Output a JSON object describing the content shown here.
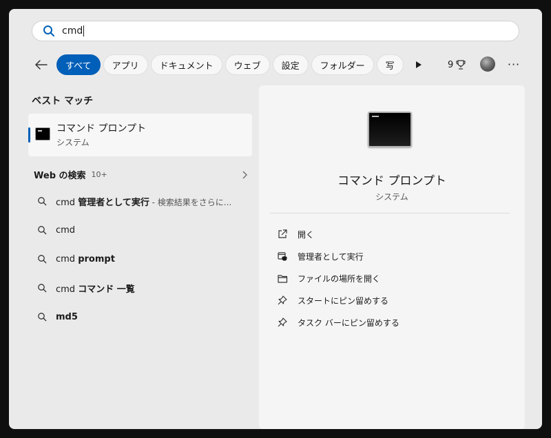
{
  "search": {
    "query": "cmd"
  },
  "filters": {
    "chips": [
      {
        "label": "すべて",
        "active": true
      },
      {
        "label": "アプリ",
        "active": false
      },
      {
        "label": "ドキュメント",
        "active": false
      },
      {
        "label": "ウェブ",
        "active": false
      },
      {
        "label": "設定",
        "active": false
      },
      {
        "label": "フォルダー",
        "active": false
      },
      {
        "label": "写",
        "active": false
      }
    ],
    "points": "9"
  },
  "left": {
    "best_match_title": "ベスト マッチ",
    "best_match": {
      "title": "コマンド プロンプト",
      "subtitle": "システム"
    },
    "web_title": "Web の検索",
    "web_count": "10+",
    "results": [
      {
        "plain": "cmd ",
        "bold": "管理者として実行",
        "suffix": " - 検索結果をさらに..."
      },
      {
        "plain": "cmd",
        "bold": "",
        "suffix": ""
      },
      {
        "plain": "cmd ",
        "bold": "prompt",
        "suffix": ""
      },
      {
        "plain": "cmd ",
        "bold": "コマンド 一覧",
        "suffix": ""
      },
      {
        "plain": "",
        "bold": "md5",
        "suffix": ""
      }
    ]
  },
  "detail": {
    "title": "コマンド プロンプト",
    "subtitle": "システム",
    "actions": [
      {
        "label": "開く",
        "icon": "open-external-icon"
      },
      {
        "label": "管理者として実行",
        "icon": "run-as-admin-icon"
      },
      {
        "label": "ファイルの場所を開く",
        "icon": "folder-icon"
      },
      {
        "label": "スタートにピン留めする",
        "icon": "pin-icon"
      },
      {
        "label": "タスク バーにピン留めする",
        "icon": "pin-icon"
      }
    ]
  },
  "colors": {
    "accent": "#005fb8",
    "window": "#eaeaea",
    "detail": "#f5f5f5"
  }
}
